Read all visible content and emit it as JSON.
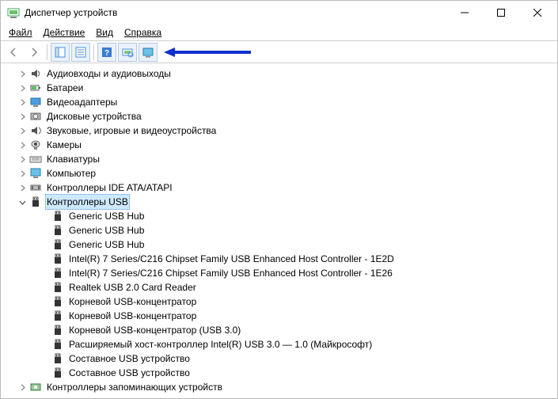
{
  "window": {
    "title": "Диспетчер устройств"
  },
  "menu": {
    "file": "Файл",
    "action": "Действие",
    "view": "Вид",
    "help": "Справка"
  },
  "tree": {
    "categories": [
      {
        "icon": "audio",
        "label": "Аудиовходы и аудиовыходы",
        "expanded": false
      },
      {
        "icon": "battery",
        "label": "Батареи",
        "expanded": false
      },
      {
        "icon": "display",
        "label": "Видеоадаптеры",
        "expanded": false
      },
      {
        "icon": "disk",
        "label": "Дисковые устройства",
        "expanded": false
      },
      {
        "icon": "sound",
        "label": "Звуковые, игровые и видеоустройства",
        "expanded": false
      },
      {
        "icon": "camera",
        "label": "Камеры",
        "expanded": false
      },
      {
        "icon": "keyboard",
        "label": "Клавиатуры",
        "expanded": false
      },
      {
        "icon": "computer",
        "label": "Компьютер",
        "expanded": false
      },
      {
        "icon": "ide",
        "label": "Контроллеры IDE ATA/ATAPI",
        "expanded": false
      },
      {
        "icon": "usb",
        "label": "Контроллеры USB",
        "expanded": true,
        "selected": true,
        "children": [
          {
            "icon": "usb-plug",
            "label": "Generic USB Hub"
          },
          {
            "icon": "usb-plug",
            "label": "Generic USB Hub"
          },
          {
            "icon": "usb-plug",
            "label": "Generic USB Hub"
          },
          {
            "icon": "usb-plug",
            "label": "Intel(R) 7 Series/C216 Chipset Family USB Enhanced Host Controller - 1E2D"
          },
          {
            "icon": "usb-plug",
            "label": "Intel(R) 7 Series/C216 Chipset Family USB Enhanced Host Controller - 1E26"
          },
          {
            "icon": "usb-plug",
            "label": "Realtek USB 2.0 Card Reader"
          },
          {
            "icon": "usb-plug",
            "label": "Корневой USB-концентратор"
          },
          {
            "icon": "usb-plug",
            "label": "Корневой USB-концентратор"
          },
          {
            "icon": "usb-plug",
            "label": "Корневой USB-концентратор (USB 3.0)"
          },
          {
            "icon": "usb-plug",
            "label": "Расширяемый хост-контроллер Intel(R) USB 3.0 — 1.0 (Майкрософт)"
          },
          {
            "icon": "usb-plug",
            "label": "Составное USB устройство"
          },
          {
            "icon": "usb-plug",
            "label": "Составное USB устройство"
          }
        ]
      },
      {
        "icon": "storage",
        "label": "Контроллеры запоминающих устройств",
        "expanded": false
      }
    ]
  }
}
